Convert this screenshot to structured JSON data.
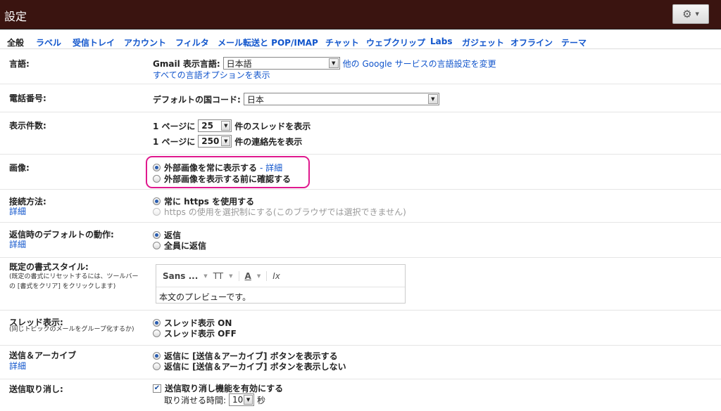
{
  "window": {
    "title": "設定"
  },
  "tabs": [
    "全般",
    "ラベル",
    "受信トレイ",
    "アカウント",
    "フィルタ",
    "メール転送と POP/IMAP",
    "チャット",
    "ウェブクリップ",
    "Labs",
    "ガジェット",
    "オフライン",
    "テーマ"
  ],
  "language": {
    "label": "言語:",
    "field_label": "Gmail 表示言語:",
    "value": "日本語",
    "other_link": "他の Google サービスの言語設定を変更",
    "all_link": "すべての言語オプションを表示"
  },
  "phone": {
    "label": "電話番号:",
    "field_label": "デフォルトの国コード:",
    "value": "日本"
  },
  "page_size": {
    "label": "表示件数:",
    "prefix1": "1 ページに",
    "value1": "25",
    "suffix1": "件のスレッドを表示",
    "prefix2": "1 ページに",
    "value2": "250",
    "suffix2": "件の連絡先を表示"
  },
  "images": {
    "label": "画像:",
    "opt1": "外部画像を常に表示する",
    "opt1_link": "- 詳細",
    "opt2": "外部画像を表示する前に確認する",
    "highlight_color": "#e0198e"
  },
  "connection": {
    "label": "接続方法:",
    "detail": "詳細",
    "opt1": "常に https を使用する",
    "opt2": "https の使用を選択制にする(このブラウザでは選択できません)"
  },
  "reply": {
    "label": "返信時のデフォルトの動作:",
    "detail": "詳細",
    "opt1": "返信",
    "opt2": "全員に返信"
  },
  "text_style": {
    "label": "既定の書式スタイル:",
    "note1": "(既定の書式にリセットするには、ツールバー",
    "note2": "の [書式をクリア] をクリックします)",
    "font": "Sans ...",
    "size_icon": "TT",
    "color_icon": "A",
    "clear_icon": "Ix",
    "preview": "本文のプレビューです。"
  },
  "threading": {
    "label": "スレッド表示:",
    "note": "(同じトピックのメールをグループ化するか)",
    "opt1": "スレッド表示 ON",
    "opt2": "スレッド表示 OFF"
  },
  "send_archive": {
    "label": "送信＆アーカイブ",
    "detail": "詳細",
    "opt1": "返信に [送信＆アーカイブ] ボタンを表示する",
    "opt2": "返信に [送信＆アーカイブ] ボタンを表示しない"
  },
  "undo_send": {
    "label": "送信取り消し:",
    "checkbox": "送信取り消し機能を有効にする",
    "period_label": "取り消せる時間:",
    "value": "10",
    "unit": "秒"
  },
  "icons": {
    "gear": "gear-icon",
    "caret": "chevron-down-icon"
  },
  "colors": {
    "titlebar": "#3a1410",
    "link": "#1155cc",
    "radio_dot": "#2a5db0"
  }
}
